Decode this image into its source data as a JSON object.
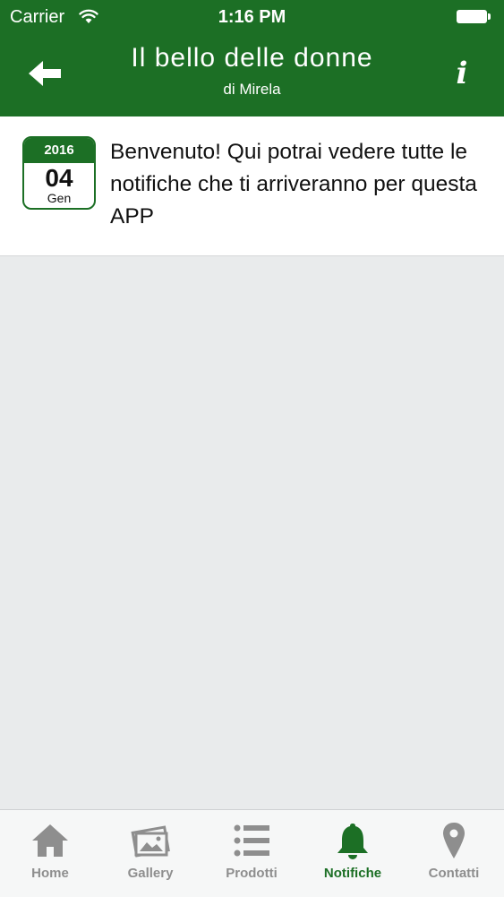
{
  "status_bar": {
    "carrier": "Carrier",
    "time": "1:16 PM"
  },
  "header": {
    "title": "Il bello delle donne",
    "subtitle": "di Mirela",
    "info_label": "i"
  },
  "notification": {
    "year": "2016",
    "day": "04",
    "month": "Gen",
    "message": "Benvenuto! Qui potrai vedere tutte le notifiche che ti arriveranno per questa APP"
  },
  "tabs": [
    {
      "label": "Home",
      "icon": "home-icon",
      "active": false
    },
    {
      "label": "Gallery",
      "icon": "gallery-icon",
      "active": false
    },
    {
      "label": "Prodotti",
      "icon": "list-icon",
      "active": false
    },
    {
      "label": "Notifiche",
      "icon": "bell-icon",
      "active": true
    },
    {
      "label": "Contatti",
      "icon": "location-pin-icon",
      "active": false
    }
  ],
  "colors": {
    "brand_green": "#1c6f25",
    "tab_inactive": "#8e8e8e",
    "background": "#e9ebec"
  }
}
